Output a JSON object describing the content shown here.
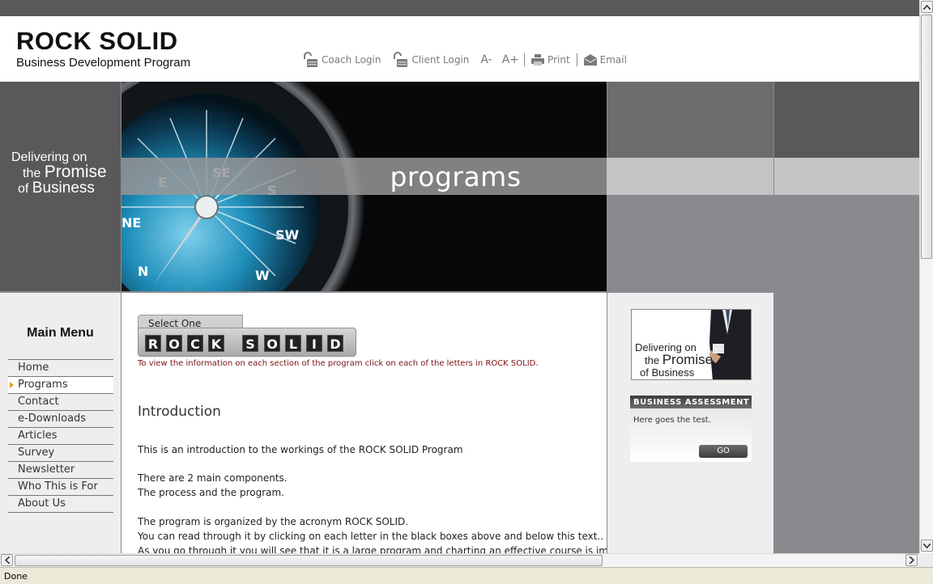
{
  "brand": {
    "title": "ROCK SOLID",
    "subtitle": "Business Development Program"
  },
  "toolbar": {
    "coach_login": "Coach Login",
    "client_login": "Client Login",
    "font_decrease": "A-",
    "font_increase": "A+",
    "print": "Print",
    "email": "Email"
  },
  "banner": {
    "tagline_line1": "Delivering on",
    "tagline_the": "the",
    "tagline_promise": "Promise",
    "tagline_of": "of",
    "tagline_business": "Business",
    "page_title": "programs"
  },
  "sidebar": {
    "menu_title": "Main Menu",
    "items": [
      {
        "label": "Home"
      },
      {
        "label": "Programs",
        "active": true
      },
      {
        "label": "Contact"
      },
      {
        "label": "e-Downloads"
      },
      {
        "label": "Articles"
      },
      {
        "label": "Survey"
      },
      {
        "label": "Newsletter"
      },
      {
        "label": "Who This is For"
      },
      {
        "label": "About Us"
      }
    ]
  },
  "content": {
    "select_label": "Select One",
    "letters": [
      "R",
      "O",
      "C",
      "K",
      "S",
      "O",
      "L",
      "I",
      "D"
    ],
    "select_hint": "To view the information on each section of the program click on each of the letters in ROCK SOLID.",
    "intro_title": "Introduction",
    "paragraphs": [
      "This is an introduction to the workings of the ROCK SOLID Program",
      "There are 2 main components.",
      "The process and the program.",
      "The program is organized by the acronym ROCK SOLID.",
      "You can read through it by clicking on each letter in the black boxes above and below this text..",
      "As you go through it you will see that it is a large program and charting an effective course is important."
    ]
  },
  "right": {
    "promo_line1": "Delivering on",
    "promo_the": "the",
    "promo_promise": "Promise",
    "promo_of": "of",
    "promo_business": "Business",
    "assessment_title": "BUSINESS ASSESSMENT",
    "assessment_text": "Here goes the test.",
    "go_label": "GO"
  },
  "status": {
    "text": "Done"
  },
  "colors": {
    "dark_gray": "#59595b",
    "mid_gray": "#888a8e",
    "hint_red": "#7a1010",
    "active_arrow": "#e2a02a"
  }
}
